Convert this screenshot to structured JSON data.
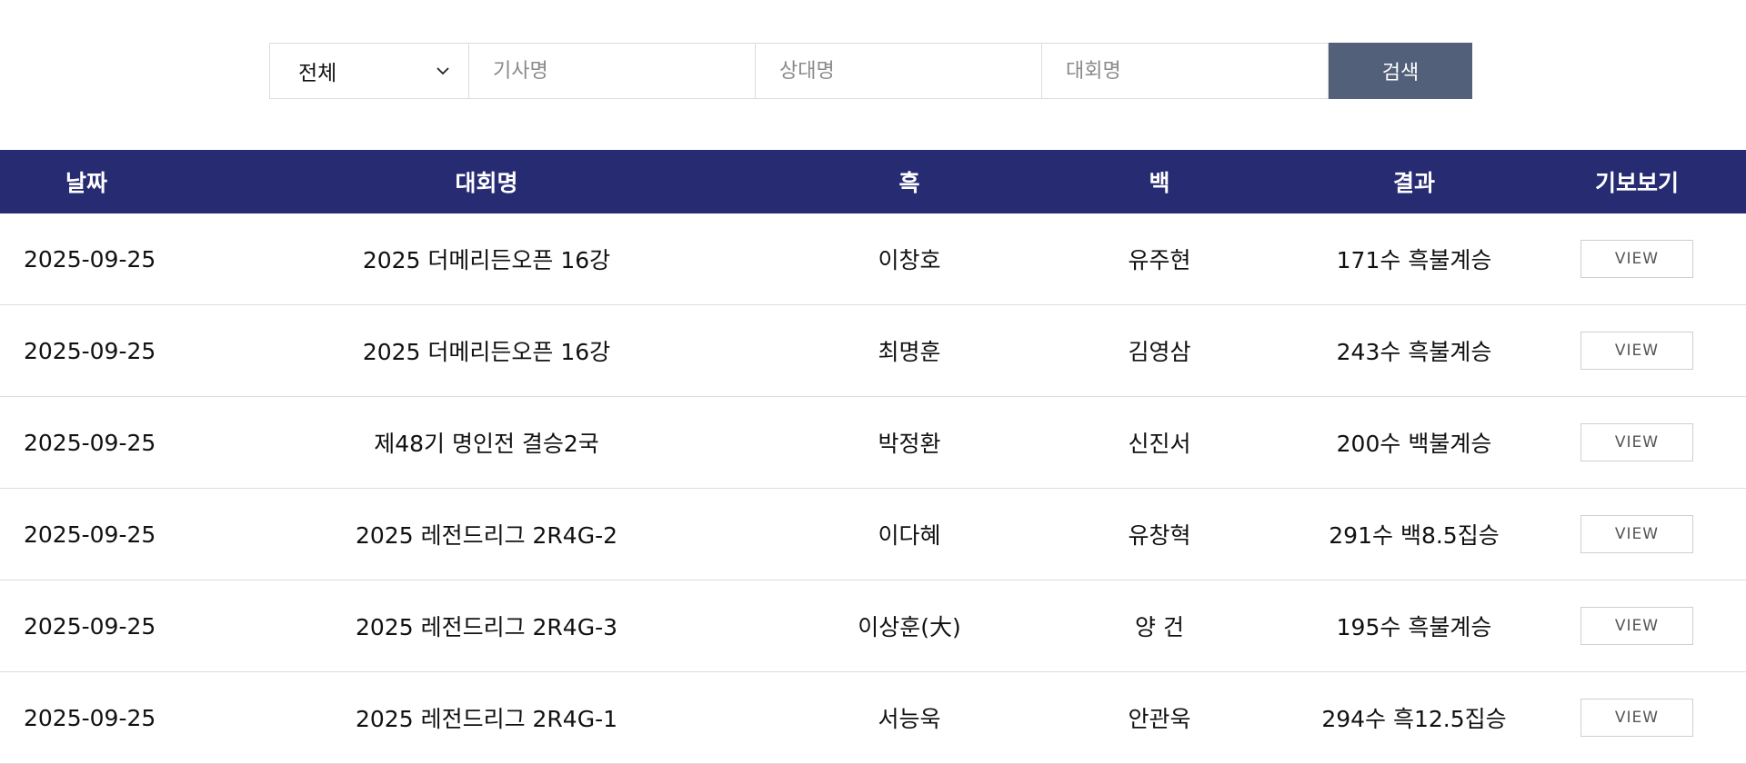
{
  "search": {
    "filter_selected": "전체",
    "player_placeholder": "기사명",
    "opponent_placeholder": "상대명",
    "tournament_placeholder": "대회명",
    "search_label": "검색"
  },
  "table": {
    "headers": {
      "date": "날짜",
      "tournament": "대회명",
      "black": "흑",
      "white": "백",
      "result": "결과",
      "view": "기보보기"
    },
    "rows": [
      {
        "date": "2025-09-25",
        "tournament": "2025 더메리든오픈 16강",
        "black": "이창호",
        "white": "유주현",
        "result": "171수 흑불계승",
        "winner": "black",
        "view": "VIEW"
      },
      {
        "date": "2025-09-25",
        "tournament": "2025 더메리든오픈 16강",
        "black": "최명훈",
        "white": "김영삼",
        "result": "243수 흑불계승",
        "winner": "black",
        "view": "VIEW"
      },
      {
        "date": "2025-09-25",
        "tournament": "제48기 명인전 결승2국",
        "black": "박정환",
        "white": "신진서",
        "result": "200수 백불계승",
        "winner": "white",
        "view": "VIEW"
      },
      {
        "date": "2025-09-25",
        "tournament": "2025 레전드리그 2R4G-2",
        "black": "이다혜",
        "white": "유창혁",
        "result": "291수 백8.5집승",
        "winner": "white",
        "view": "VIEW"
      },
      {
        "date": "2025-09-25",
        "tournament": "2025 레전드리그 2R4G-3",
        "black": "이상훈(大)",
        "white": "양 건",
        "result": "195수 흑불계승",
        "winner": "black",
        "view": "VIEW"
      },
      {
        "date": "2025-09-25",
        "tournament": "2025 레전드리그 2R4G-1",
        "black": "서능욱",
        "white": "안관욱",
        "result": "294수 흑12.5집승",
        "winner": "black",
        "view": "VIEW"
      }
    ]
  },
  "colors": {
    "header_bg": "#262b72",
    "search_button_bg": "#52607a",
    "winner_text": "#4a86e8"
  }
}
